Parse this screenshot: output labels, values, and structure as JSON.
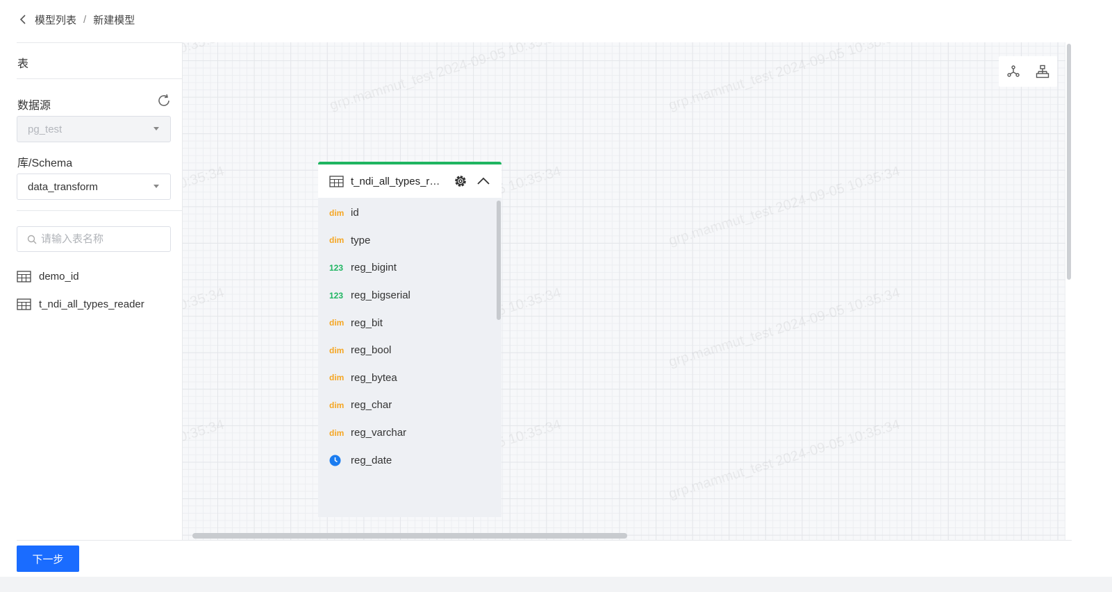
{
  "breadcrumb": {
    "parent": "模型列表",
    "separator": "/",
    "current": "新建模型"
  },
  "sidebar": {
    "tab_label": "表",
    "datasource_label": "数据源",
    "datasource_value": "pg_test",
    "schema_label": "库/Schema",
    "schema_value": "data_transform",
    "search_placeholder": "请输入表名称",
    "tables": [
      {
        "name": "demo_id"
      },
      {
        "name": "t_ndi_all_types_reader"
      }
    ]
  },
  "canvas": {
    "watermark": "grp.mammut_test 2024-09-05 10:35:34",
    "node": {
      "title": "t_ndi_all_types_reader",
      "fields": [
        {
          "tag": "dim",
          "kind": "dim",
          "name": "id"
        },
        {
          "tag": "dim",
          "kind": "dim",
          "name": "type"
        },
        {
          "tag": "123",
          "kind": "num",
          "name": "reg_bigint"
        },
        {
          "tag": "123",
          "kind": "num",
          "name": "reg_bigserial"
        },
        {
          "tag": "dim",
          "kind": "dim",
          "name": "reg_bit"
        },
        {
          "tag": "dim",
          "kind": "dim",
          "name": "reg_bool"
        },
        {
          "tag": "dim",
          "kind": "dim",
          "name": "reg_bytea"
        },
        {
          "tag": "dim",
          "kind": "dim",
          "name": "reg_char"
        },
        {
          "tag": "dim",
          "kind": "dim",
          "name": "reg_varchar"
        },
        {
          "tag": "clock-icon",
          "kind": "time",
          "name": "reg_date"
        }
      ]
    }
  },
  "footer": {
    "next_label": "下一步"
  },
  "colors": {
    "primary": "#1a6cff",
    "node_accent": "#1fb561",
    "dim_tag": "#f5a623",
    "num_tag": "#1fb561",
    "time_tag": "#1a7cf0"
  }
}
